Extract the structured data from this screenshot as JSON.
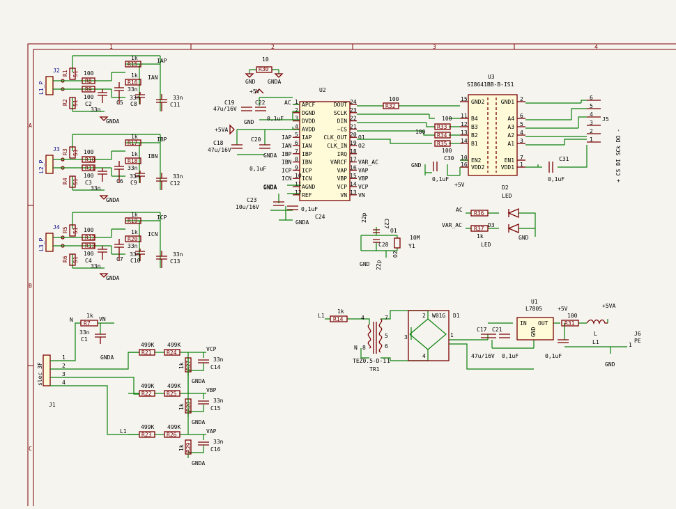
{
  "colors": {
    "wire": "#0a7f0a",
    "component": "#7a0000",
    "component_fill": "#fffbd8",
    "text": "#000000",
    "background": "#f5f4ef"
  },
  "frame": {
    "cols": [
      "1",
      "2",
      "3",
      "4"
    ],
    "rows": [
      "A",
      "B",
      "C"
    ]
  },
  "inputs": {
    "j2": {
      "ref": "J2",
      "net": "L1_P",
      "r_top": "R1",
      "r_top_val": "51",
      "r_bot": "R2",
      "r_bot_val": "51",
      "rs_a": "R8",
      "rs_a_val": "100",
      "rs_b": "R9",
      "rs_b_val": "100",
      "cap": "C2",
      "cap_val": "33n",
      "rp": "R15",
      "rp_val": "1k",
      "rn": "R16",
      "rn_val": "1k",
      "cp1": "C5",
      "cp1_val": "33n",
      "cp2": "C8",
      "cp2_val": "33n",
      "cp3": "C11",
      "cp3_val": "33n",
      "net_p": "IAP",
      "net_n": "IAN",
      "gnd": "GNDA"
    },
    "j3": {
      "ref": "J3",
      "net": "L2_P",
      "r_top": "R3",
      "r_top_val": "51",
      "r_bot": "R4",
      "r_bot_val": "51",
      "rs_a": "R10",
      "rs_a_val": "100",
      "rs_b": "R11",
      "rs_b_val": "100",
      "cap": "C3",
      "cap_val": "33n",
      "rp": "R17",
      "rp_val": "1k",
      "rn": "R18",
      "rn_val": "1k",
      "cp1": "C6",
      "cp1_val": "33n",
      "cp2": "C9",
      "cp2_val": "33n",
      "cp3": "C12",
      "cp3_val": "33n",
      "net_p": "IBP",
      "net_n": "IBN",
      "gnd": "GNDA"
    },
    "j4": {
      "ref": "J4",
      "net": "L3_P",
      "r_top": "R5",
      "r_top_val": "51",
      "r_bot": "R6",
      "r_bot_val": "51",
      "rs_a": "R12",
      "rs_a_val": "100",
      "rs_b": "R13",
      "rs_b_val": "100",
      "cap": "C4",
      "cap_val": "33n",
      "rp": "R19",
      "rp_val": "1k",
      "rn": "R20",
      "rn_val": "1k",
      "cp1": "C7",
      "cp1_val": "33n",
      "cp2": "C10",
      "cp2_val": "33n",
      "cp3": "C13",
      "cp3_val": "33n",
      "net_p": "ICP",
      "net_n": "ICN",
      "gnd": "GNDA"
    }
  },
  "u2": {
    "ref": "U2",
    "left_pins": [
      {
        "num": "1",
        "name": "APCF"
      },
      {
        "num": "2",
        "name": "DGND"
      },
      {
        "num": "3",
        "name": "DVDD"
      },
      {
        "num": "4",
        "name": "AVDD"
      },
      {
        "num": "5",
        "name": "IAP"
      },
      {
        "num": "6",
        "name": "IAN"
      },
      {
        "num": "7",
        "name": "IBP"
      },
      {
        "num": "8",
        "name": "IBN"
      },
      {
        "num": "9",
        "name": "ICP"
      },
      {
        "num": "10",
        "name": "ICN"
      },
      {
        "num": "11",
        "name": "AGND"
      },
      {
        "num": "12",
        "name": "REF"
      }
    ],
    "right_pins": [
      {
        "num": "24",
        "name": "DOUT"
      },
      {
        "num": "23",
        "name": "SCLK"
      },
      {
        "num": "22",
        "name": "DIN"
      },
      {
        "num": "21",
        "name": "~CS"
      },
      {
        "num": "20",
        "name": "CLK_OUT"
      },
      {
        "num": "19",
        "name": "CLK_IN"
      },
      {
        "num": "18",
        "name": "IRQ"
      },
      {
        "num": "17",
        "name": "VARCF"
      },
      {
        "num": "16",
        "name": "VAP"
      },
      {
        "num": "15",
        "name": "VBP"
      },
      {
        "num": "14",
        "name": "VCP"
      },
      {
        "num": "13",
        "name": "VN"
      }
    ],
    "left_nets": [
      "AC",
      "",
      "",
      "+5VA",
      "IAP",
      "IAN",
      "IBP",
      "IBN",
      "ICP",
      "ICN",
      "GNDA",
      ""
    ],
    "right_nets": [
      "",
      "",
      "",
      "",
      "O1",
      "O2",
      "",
      "VAR_AC",
      "VAP",
      "VBP",
      "VCP",
      "VN"
    ]
  },
  "u2_parts": {
    "r30": "R30",
    "r30_val": "10",
    "gnd": "GND",
    "gnda": "GNDA",
    "c19": "C19",
    "c19_val": "47u/16V",
    "c22": "C22",
    "c22_val": "0,1uF",
    "p5v": "+5V",
    "c18": "C18",
    "c18_val": "47u/16V",
    "c20": "C20",
    "c20_val": "0,1uF",
    "p5va": "+5VA",
    "c23": "C23",
    "c23_val": "10u/16V",
    "c24": "C24",
    "c24_val": "0,1uF",
    "ac": "AC"
  },
  "u3": {
    "ref": "U3",
    "part": "SI8641BB-B-IS1",
    "left_pins": [
      {
        "num": "15",
        "name": "GND2"
      },
      {
        "num": "11",
        "name": "B4"
      },
      {
        "num": "12",
        "name": "B3"
      },
      {
        "num": "13",
        "name": "B2"
      },
      {
        "num": "14",
        "name": "B1"
      },
      {
        "num": "10",
        "name": "EN2"
      },
      {
        "num": "16",
        "name": "VDD2"
      }
    ],
    "right_pins": [
      {
        "num": "2",
        "name": "GND1"
      },
      {
        "num": "6",
        "name": "A4"
      },
      {
        "num": "5",
        "name": "A3"
      },
      {
        "num": "4",
        "name": "A2"
      },
      {
        "num": "3",
        "name": "A1"
      },
      {
        "num": "7",
        "name": "EN1"
      },
      {
        "num": "1",
        "name": "VDD1"
      }
    ]
  },
  "u3_parts": {
    "r32": "R32",
    "r32_val": "100",
    "r33": "R33",
    "r34": "R34",
    "r35": "R35",
    "val100": "100",
    "c30": "C30",
    "c30_val": "0,1uF",
    "c31": "C31",
    "c31_val": "0,1uF",
    "gnd": "GND",
    "p5v": "+5V",
    "j5": "J5",
    "j5_pins": [
      "6",
      "5",
      "4",
      "3",
      "2",
      "1"
    ],
    "j5_label": "+ CS DI SCk DO -"
  },
  "leds": {
    "d2": "D2",
    "d2_val": "LED",
    "d3": "D3",
    "d3_val": "LED",
    "r36": "R36",
    "r37": "R37",
    "r_val": "1k",
    "net_a": "AC",
    "net_b": "VAR_AC",
    "gnd": "GND"
  },
  "osc": {
    "c27": "C27",
    "c27_val": "22p",
    "c28": "C28",
    "c28_val": "22p",
    "y1": "Y1",
    "y1_val": "10M",
    "o1": "O1",
    "o2": "O2",
    "gnd": "GND"
  },
  "supply": {
    "l1": "L1",
    "r14": "R14",
    "r14_val": "1k",
    "tr1": "TR1",
    "tr1_val": "TEZ0.5-D-1",
    "n": "N",
    "d1": "D1",
    "d1_val": "W01G",
    "c17": "C17",
    "c21": "C21",
    "c17_val": "47u/16V",
    "c21_val": "0,1uF",
    "u1": "U1",
    "u1_val": "L7805",
    "u1_in": "IN",
    "u1_out": "OUT",
    "u1_gnd": "GND",
    "r31": "R31",
    "r31_val": "100",
    "c_out_val": "0,1uF",
    "p5v": "+5V",
    "p5va": "+5VA",
    "l": "L",
    "l_ref": "L1",
    "j6": "J6",
    "j6_val": "PE",
    "j6_pin": "1",
    "gnd": "GND",
    "tr_pins": [
      "4",
      "7",
      "5",
      "8",
      "6",
      "1"
    ],
    "d1_pins": [
      "2",
      "1",
      "3",
      "4"
    ]
  },
  "voltage": {
    "j1": "J1",
    "j1_val": "slec 3F",
    "j1_pins": [
      "1",
      "2",
      "3",
      "4"
    ],
    "n": "N",
    "r7": "R7",
    "r7_val": "1k",
    "vn": "VN",
    "c1": "C1",
    "c1_val": "33n",
    "gnda": "GNDA",
    "l1": "L1",
    "chains": [
      {
        "ra": "R21",
        "rb": "R24",
        "rv": "499K",
        "rc": "R27",
        "rcv": "1k",
        "c": "C14",
        "cv": "33n",
        "net": "VCP"
      },
      {
        "ra": "R22",
        "rb": "R25",
        "rv": "499K",
        "rc": "R28",
        "rcv": "1k",
        "c": "C15",
        "cv": "33n",
        "net": "VBP"
      },
      {
        "ra": "R23",
        "rb": "R26",
        "rv": "499K",
        "rc": "R29",
        "rcv": "1k",
        "c": "C16",
        "cv": "33n",
        "net": "VAP"
      }
    ]
  }
}
